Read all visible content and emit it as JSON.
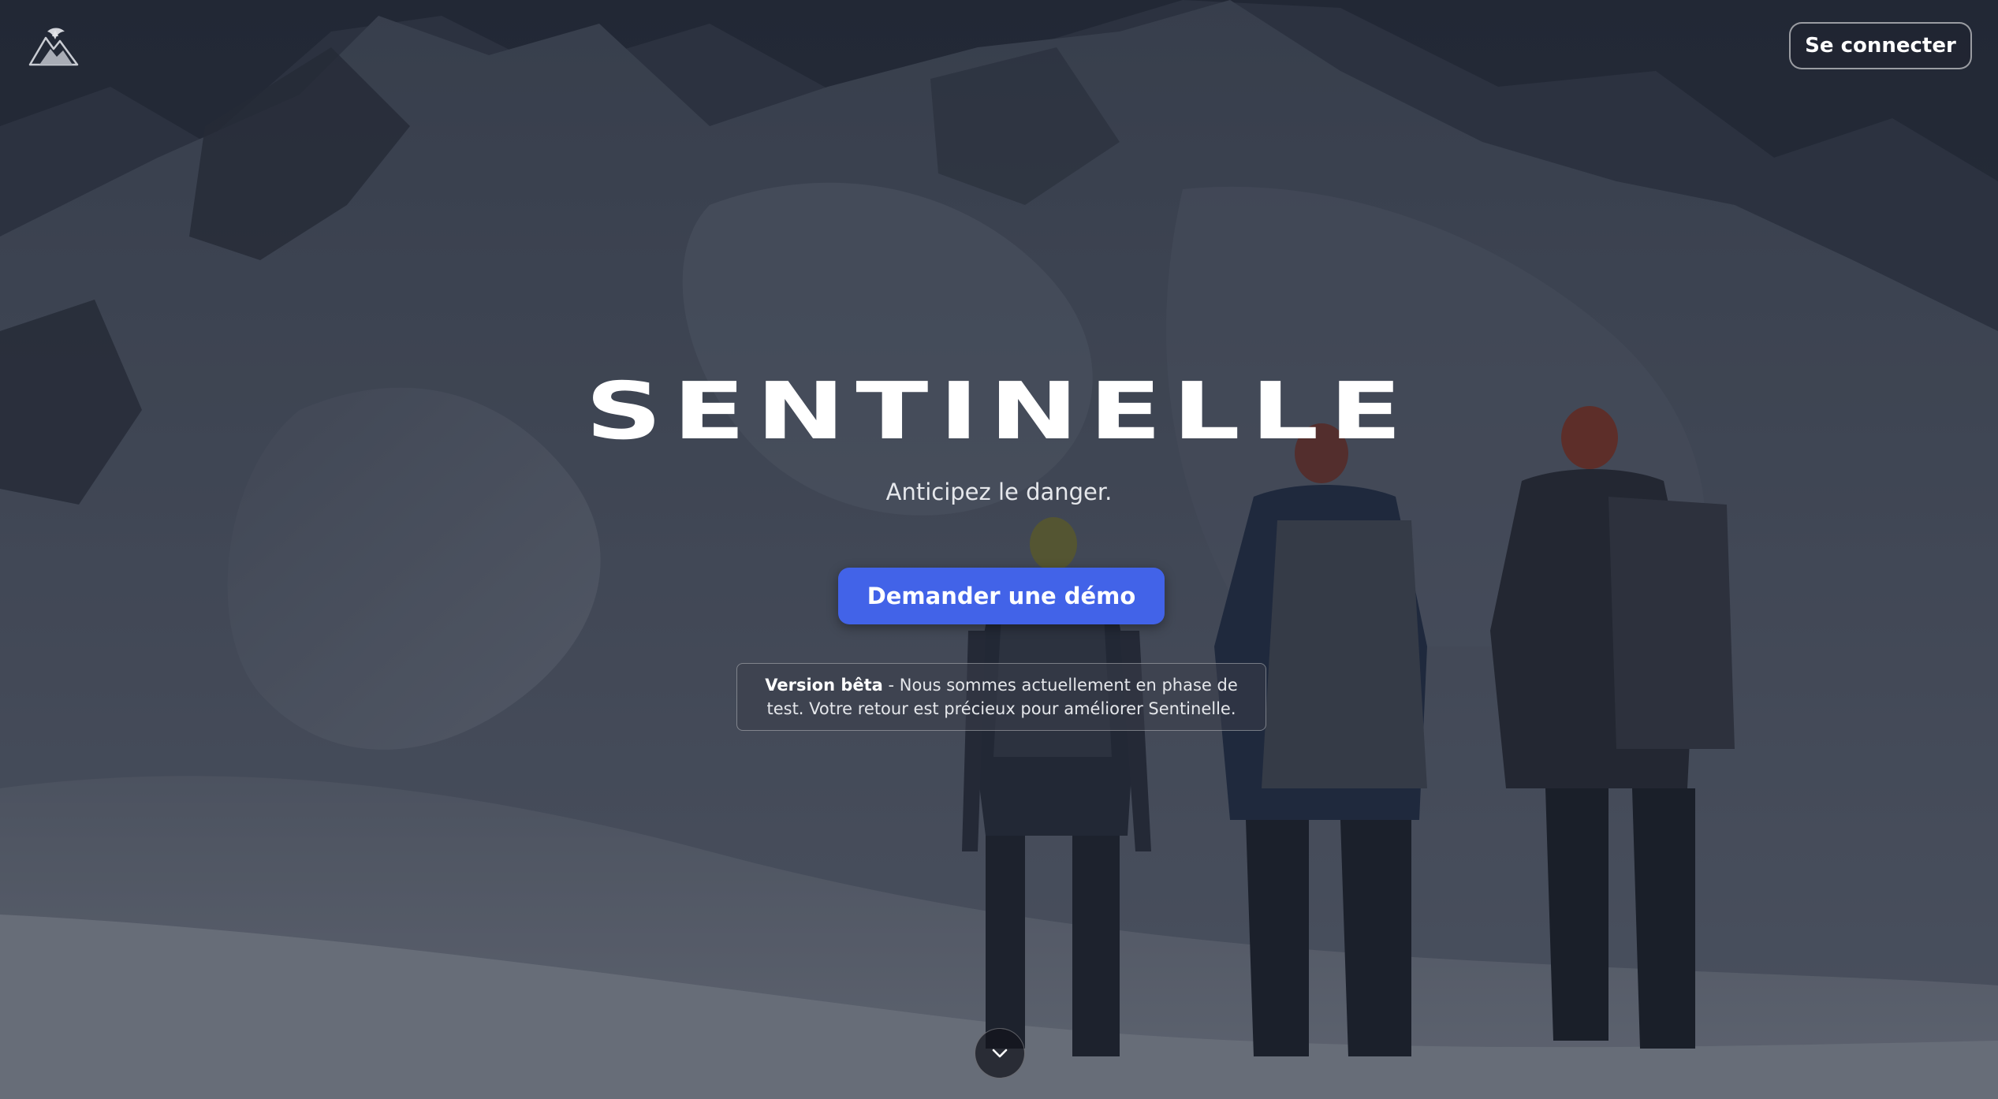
{
  "header": {
    "logo_icon": "mountain-eagle-logo-icon",
    "login_label": "Se connecter"
  },
  "hero": {
    "title": "SENTINELLE",
    "subtitle": "Anticipez le danger.",
    "cta_label": "Demander une démo",
    "beta_bold": "Version bêta",
    "beta_text": " - Nous sommes actuellement en phase de test. Votre retour est précieux pour améliorer Sentinelle.",
    "scroll_icon": "chevron-down-icon"
  },
  "colors": {
    "accent": "#4263e8",
    "text": "#ffffff"
  }
}
